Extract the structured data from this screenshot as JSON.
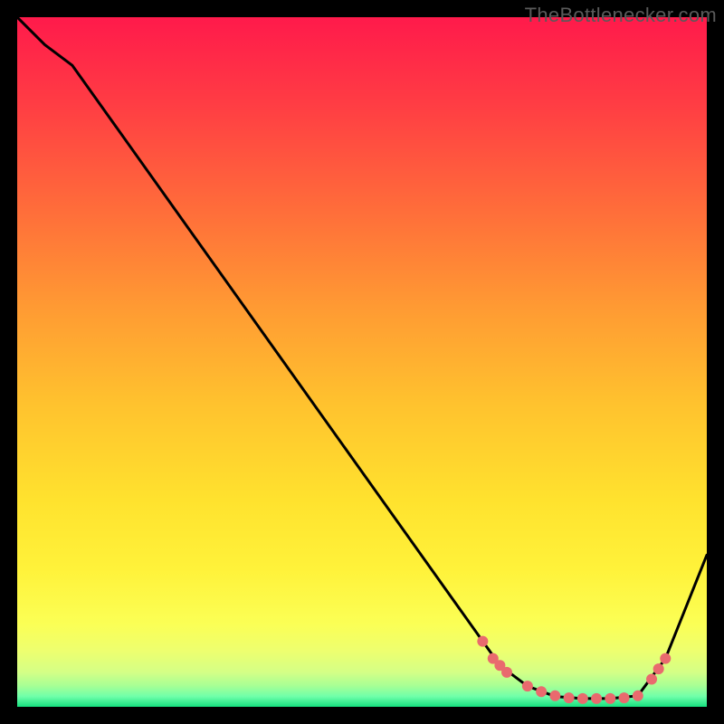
{
  "watermark": "TheBottlenecker.com",
  "colors": {
    "background": "#000000",
    "top": "#ff1a4b",
    "mid": "#ffe400",
    "bottom_band": "#c8ff87",
    "bottom_edge": "#16e07f",
    "line": "#000000",
    "marker": "#e96a6e"
  },
  "chart_data": {
    "type": "line",
    "title": "",
    "xlabel": "",
    "ylabel": "",
    "xlim": [
      0,
      100
    ],
    "ylim": [
      0,
      100
    ],
    "series": [
      {
        "name": "curve",
        "x": [
          0,
          4,
          8,
          70,
          74,
          78,
          82,
          86,
          90,
          94,
          98,
          100
        ],
        "y": [
          100,
          96,
          93,
          6,
          3,
          1.5,
          1.2,
          1.2,
          1.6,
          7,
          17,
          22
        ]
      }
    ],
    "markers": {
      "name": "highlighted-points",
      "x": [
        67.5,
        69,
        70,
        71,
        74,
        76,
        78,
        80,
        82,
        84,
        86,
        88,
        90,
        92,
        93,
        94
      ],
      "y": [
        9.5,
        7,
        6,
        5,
        3,
        2.2,
        1.6,
        1.3,
        1.2,
        1.2,
        1.2,
        1.3,
        1.6,
        4,
        5.5,
        7
      ]
    }
  }
}
